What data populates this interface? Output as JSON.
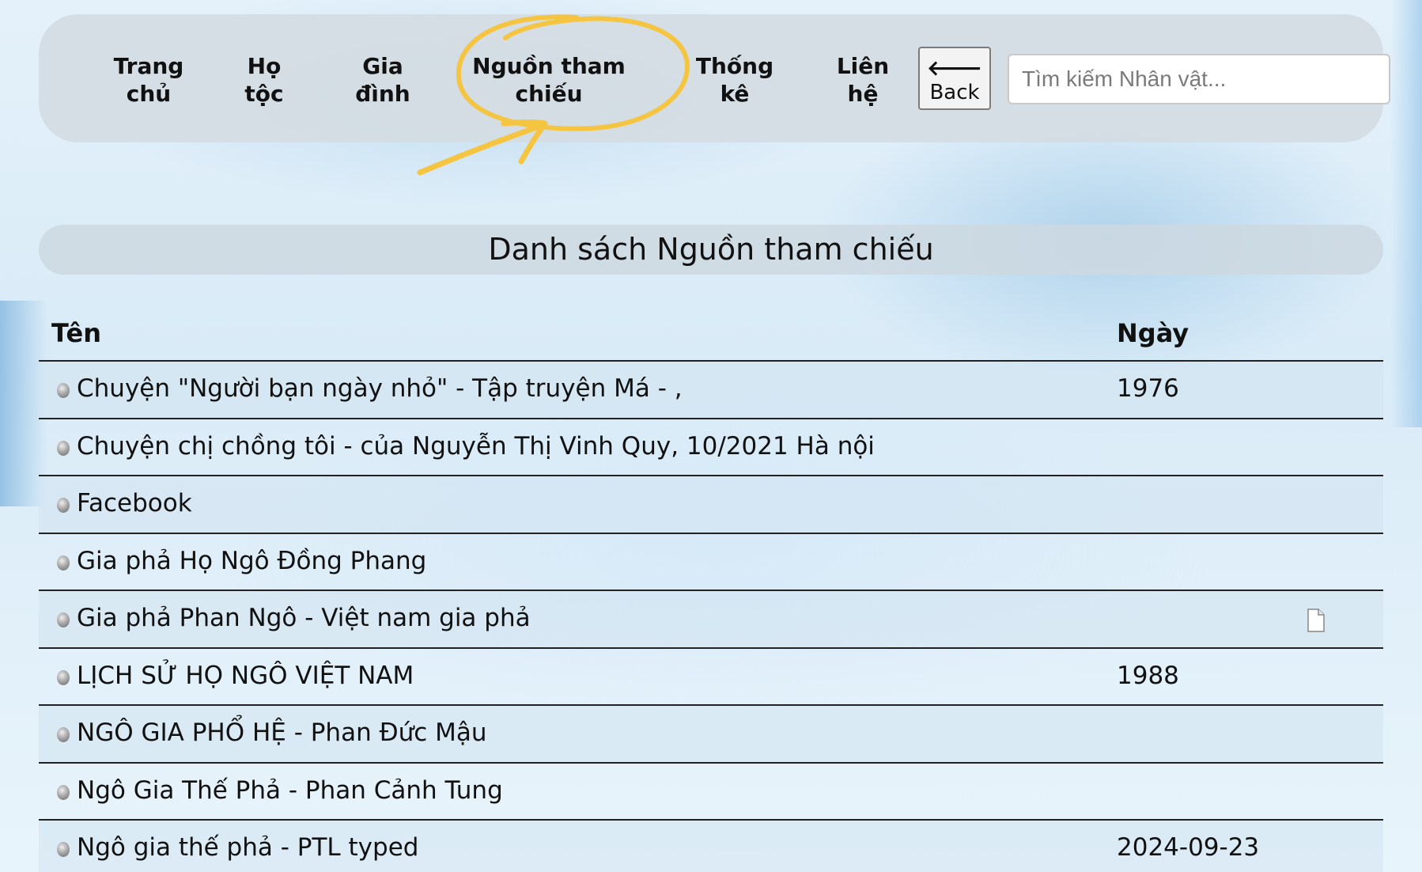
{
  "nav": {
    "items": [
      {
        "line1": "Trang",
        "line2": "chủ"
      },
      {
        "line1": "Họ",
        "line2": "tộc"
      },
      {
        "line1": "Gia",
        "line2": "đình"
      },
      {
        "line1": "Nguồn tham",
        "line2": "chiếu"
      },
      {
        "line1": "Thống",
        "line2": "kê"
      },
      {
        "line1": "Liên",
        "line2": "hệ"
      }
    ],
    "back_arrow": "🡐",
    "back_label": "Back",
    "search_placeholder": "Tìm kiếm Nhân vật...",
    "highlight_color": "#f5c542"
  },
  "page": {
    "title": "Danh sách Nguồn tham chiếu"
  },
  "table": {
    "headers": {
      "name": "Tên",
      "date": "Ngày"
    },
    "rows": [
      {
        "name": "Chuyện \"Người bạn ngày nhỏ\" - Tập truyện Má - ,",
        "date": "1976",
        "has_doc": false
      },
      {
        "name": "Chuyện chị chồng tôi - của Nguyễn Thị Vinh Quy, 10/2021 Hà nội",
        "date": "",
        "has_doc": false
      },
      {
        "name": "Facebook",
        "date": "",
        "has_doc": false
      },
      {
        "name": "Gia phả Họ Ngô Đồng Phang",
        "date": "",
        "has_doc": false
      },
      {
        "name": "Gia phả Phan Ngô - Việt nam gia phả",
        "date": "",
        "has_doc": true
      },
      {
        "name": "LỊCH SỬ HỌ NGÔ VIỆT NAM",
        "date": "1988",
        "has_doc": false
      },
      {
        "name": "NGÔ GIA PHỔ HỆ - Phan Đức Mậu",
        "date": "",
        "has_doc": false
      },
      {
        "name": "Ngô Gia Thế Phả - Phan Cảnh Tung",
        "date": "",
        "has_doc": false
      },
      {
        "name": "Ngô gia thế phả - PTL typed",
        "date": "2024-09-23",
        "has_doc": false
      }
    ]
  }
}
